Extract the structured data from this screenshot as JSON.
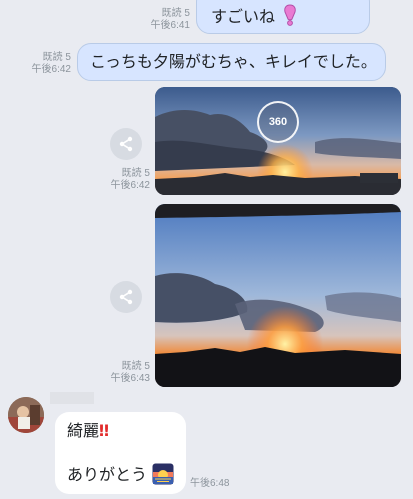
{
  "messages": [
    {
      "type": "text",
      "read": "既読 5",
      "time": "午後6:41",
      "text": "すごいね"
    },
    {
      "type": "text",
      "read": "既読 5",
      "time": "午後6:42",
      "text": "こっちも夕陽がむちゃ、キレイでした。"
    },
    {
      "type": "photo",
      "read": "既読 5",
      "time": "午後6:42",
      "badge": "360"
    },
    {
      "type": "photo",
      "read": "既読 5",
      "time": "午後6:43"
    }
  ],
  "received": {
    "line1": "綺麗",
    "line1_mark": "‼",
    "line2": "ありがとう",
    "time": "午後6:48"
  },
  "icons": {
    "sent_emoji": "pink-exclamation-icon",
    "share": "share-icon",
    "sticker": "sunset-emoji-icon"
  },
  "colors": {
    "background": "#e9ebf1",
    "sent_bubble": "#d7e5ff",
    "received_bubble": "#ffffff",
    "meta_text": "#8c949c"
  }
}
